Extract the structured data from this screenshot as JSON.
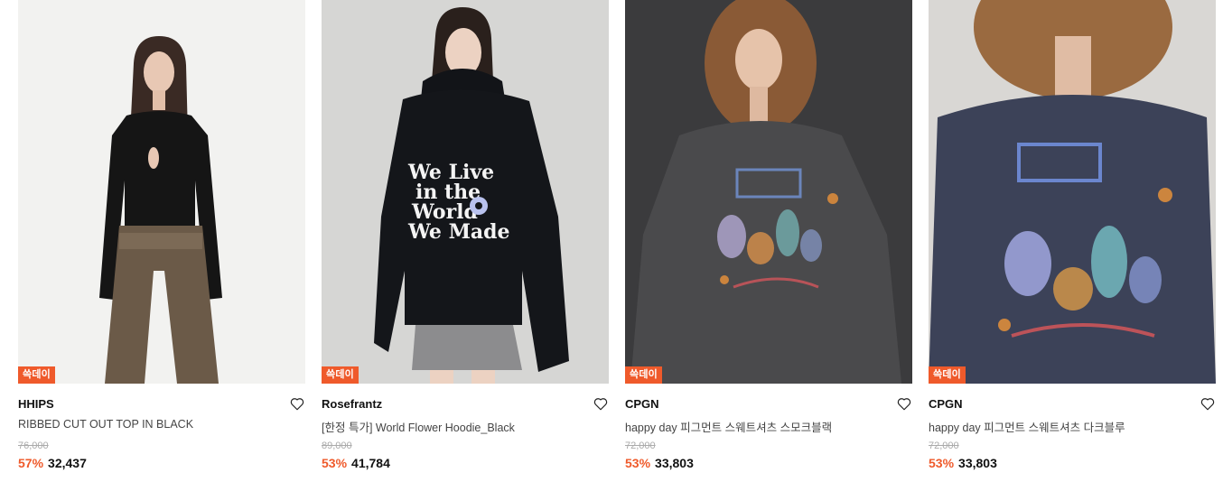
{
  "products": [
    {
      "badge": "쓱데이",
      "brand": "HHIPS",
      "name": "RIBBED CUT OUT TOP IN BLACK",
      "original_price": "76,000",
      "discount": "57%",
      "price": "32,437",
      "image_icon": "model-black-cutout-top-photo"
    },
    {
      "badge": "쓱데이",
      "brand": "Rosefrantz",
      "name": "[한정 특가] World Flower Hoodie_Black",
      "original_price": "89,000",
      "discount": "53%",
      "price": "41,784",
      "image_icon": "model-black-hoodie-photo",
      "print_text": [
        "We Live",
        "in the",
        "World",
        "We Made"
      ]
    },
    {
      "badge": "쓱데이",
      "brand": "CPGN",
      "name": "happy day 피그먼트 스웨트셔츠 스모크블랙",
      "original_price": "72,000",
      "discount": "53%",
      "price": "33,803",
      "image_icon": "model-smoke-black-sweatshirt-photo"
    },
    {
      "badge": "쓱데이",
      "brand": "CPGN",
      "name": "happy day 피그먼트 스웨트셔츠 다크블루",
      "original_price": "72,000",
      "discount": "53%",
      "price": "33,803",
      "image_icon": "model-dark-blue-sweatshirt-photo"
    }
  ],
  "colors": {
    "accent": "#ef5a2b",
    "brand_text": "#111111",
    "name_text": "#444444",
    "strike_text": "#aaaaaa"
  }
}
